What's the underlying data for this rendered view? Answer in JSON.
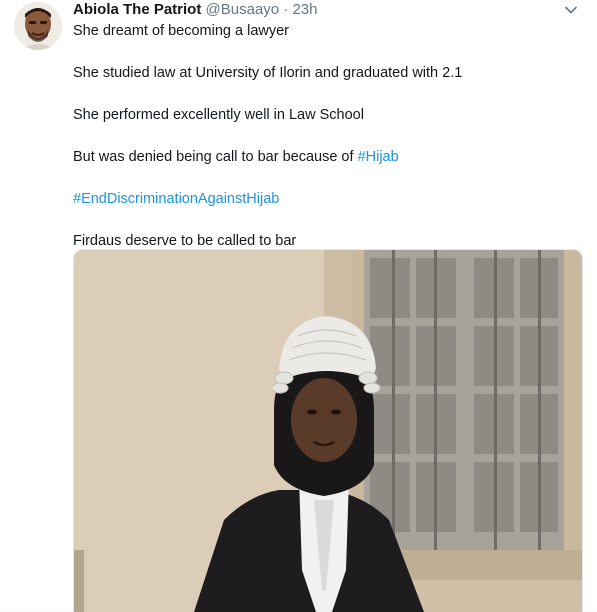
{
  "tweet": {
    "author": {
      "name": "Abiola The Patriot",
      "handle": "@Busaayo",
      "separator": "·",
      "time": "23h"
    },
    "lines": {
      "l1": "She dreamt of becoming a lawyer",
      "l2": "She studied law at University of Ilorin and graduated with 2.1",
      "l3": "She performed excellently well in Law School",
      "l4_text": "But was denied being call to bar because of ",
      "l4_hashtag": "#Hijab",
      "l5_hashtag": "#EndDiscriminationAgainstHijab",
      "l6": "Firdaus deserve to be called to bar"
    },
    "colors": {
      "link": "#1b95e0",
      "secondary_text": "#657786",
      "primary_text": "#14171a"
    },
    "icons": {
      "caret": "chevron-down-icon",
      "avatar": "user-avatar"
    }
  }
}
